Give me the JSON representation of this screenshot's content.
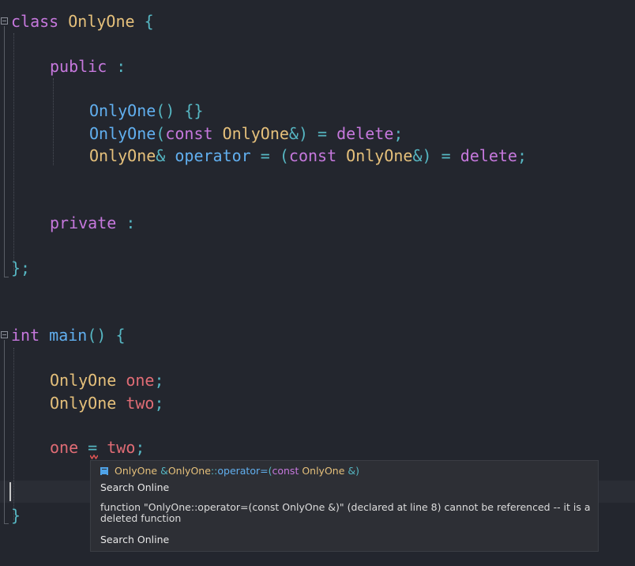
{
  "code": {
    "line1": {
      "kw": "class",
      "name": "OnlyOne",
      "brace": "{"
    },
    "line2": {
      "kw": "public",
      "colon": ":"
    },
    "line3": {
      "ctor": "OnlyOne",
      "parens": "() {}"
    },
    "line4": {
      "ctor": "OnlyOne",
      "open": "(",
      "kw": "const",
      "type": "OnlyOne",
      "amp": "&)",
      "eq": "=",
      "del": "delete",
      "semi": ";"
    },
    "line5": {
      "type": "OnlyOne",
      "amp": "&",
      "op": "operator",
      "eq": "=",
      "open": "(",
      "kw": "const",
      "type2": "OnlyOne",
      "amp2": "&)",
      "eq2": "=",
      "del": "delete",
      "semi": ";"
    },
    "line6": {
      "kw": "private",
      "colon": ":"
    },
    "line7": {
      "close": "};"
    },
    "line8": {
      "kw": "int",
      "fn": "main",
      "parens": "()",
      "brace": "{"
    },
    "line9": {
      "type": "OnlyOne",
      "var": "one",
      "semi": ";"
    },
    "line10": {
      "type": "OnlyOne",
      "var": "two",
      "semi": ";"
    },
    "line11": {
      "lhs": "one",
      "eq": "=",
      "rhs": "two",
      "semi": ";"
    },
    "line12": {
      "close": "}"
    }
  },
  "tooltip": {
    "sig_type": "OnlyOne",
    "sig_amp": "&",
    "sig_scope": "OnlyOne",
    "sig_sep": "::",
    "sig_fn": "operator=",
    "sig_open": "(",
    "sig_kw": "const",
    "sig_type2": "OnlyOne",
    "sig_close": "&)",
    "search1": "Search Online",
    "message": "function \"OnlyOne::operator=(const OnlyOne &)\" (declared at line 8) cannot be referenced -- it is a deleted function",
    "search2": "Search Online"
  },
  "colors": {
    "background": "#23262e",
    "keyword": "#c678dd",
    "type": "#e5c07b",
    "function": "#61afef",
    "punctuation": "#56b6c2",
    "variable": "#e06c75",
    "error": "#e05555"
  }
}
